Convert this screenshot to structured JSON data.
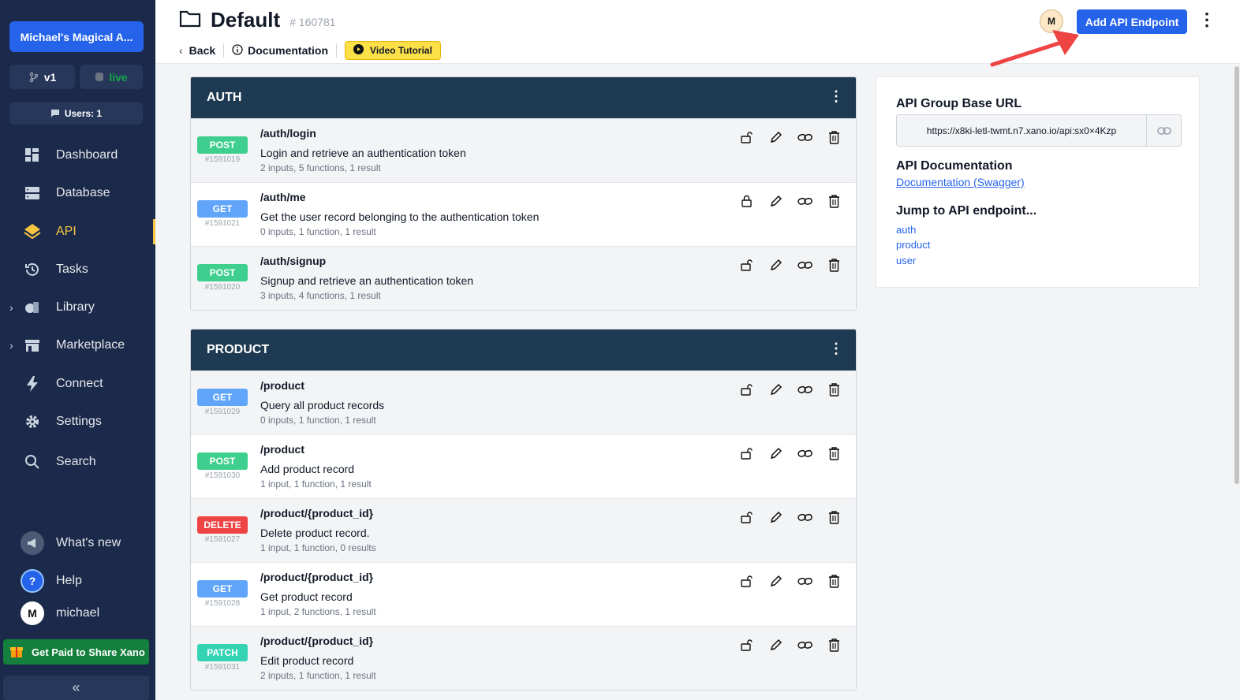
{
  "sidebar": {
    "workspace": "Michael's Magical A...",
    "branch": "v1",
    "datasource": "live",
    "users": "Users: 1",
    "nav": [
      {
        "label": "Dashboard",
        "icon": "dashboard-icon"
      },
      {
        "label": "Database",
        "icon": "database-icon"
      },
      {
        "label": "API",
        "icon": "api-icon",
        "active": true
      },
      {
        "label": "Tasks",
        "icon": "history-icon"
      },
      {
        "label": "Library",
        "icon": "library-icon"
      },
      {
        "label": "Marketplace",
        "icon": "marketplace-icon"
      },
      {
        "label": "Connect",
        "icon": "bolt-icon"
      },
      {
        "label": "Settings",
        "icon": "gear-icon"
      },
      {
        "label": "Search",
        "icon": "search-icon"
      }
    ],
    "whats_new": "What's new",
    "help": "Help",
    "user_initial": "M",
    "user_name": "michael",
    "promo": "Get Paid to Share Xano"
  },
  "header": {
    "title": "Default",
    "id": "# 160781",
    "back": "Back",
    "documentation": "Documentation",
    "video": "Video Tutorial",
    "avatar": "M",
    "add_button": "Add API Endpoint"
  },
  "groups": [
    {
      "name": "AUTH",
      "endpoints": [
        {
          "method": "POST",
          "id": "#1591019",
          "path": "/auth/login",
          "desc": "Login and retrieve an authentication token",
          "meta": "2 inputs, 5 functions, 1 result",
          "lock": "unlocked"
        },
        {
          "method": "GET",
          "id": "#1591021",
          "path": "/auth/me",
          "desc": "Get the user record belonging to the authentication token",
          "meta": "0 inputs, 1 function, 1 result",
          "lock": "locked"
        },
        {
          "method": "POST",
          "id": "#1591020",
          "path": "/auth/signup",
          "desc": "Signup and retrieve an authentication token",
          "meta": "3 inputs, 4 functions, 1 result",
          "lock": "unlocked"
        }
      ]
    },
    {
      "name": "PRODUCT",
      "endpoints": [
        {
          "method": "GET",
          "id": "#1591029",
          "path": "/product",
          "desc": "Query all product records",
          "meta": "0 inputs, 1 function, 1 result",
          "lock": "unlocked"
        },
        {
          "method": "POST",
          "id": "#1591030",
          "path": "/product",
          "desc": "Add product record",
          "meta": "1 input, 1 function, 1 result",
          "lock": "unlocked"
        },
        {
          "method": "DELETE",
          "id": "#1591027",
          "path": "/product/{product_id}",
          "desc": "Delete product record.",
          "meta": "1 input, 1 function, 0 results",
          "lock": "unlocked"
        },
        {
          "method": "GET",
          "id": "#1591028",
          "path": "/product/{product_id}",
          "desc": "Get product record",
          "meta": "1 input, 2 functions, 1 result",
          "lock": "unlocked"
        },
        {
          "method": "PATCH",
          "id": "#1591031",
          "path": "/product/{product_id}",
          "desc": "Edit product record",
          "meta": "2 inputs, 1 function, 1 result",
          "lock": "unlocked"
        }
      ]
    }
  ],
  "panel": {
    "base_url_title": "API Group Base URL",
    "base_url": "https://x8ki-letl-twmt.n7.xano.io/api:sx0×4Kzp",
    "doc_title": "API Documentation",
    "doc_link": "Documentation (Swagger)",
    "jump_title": "Jump to API endpoint...",
    "jump_links": [
      "auth",
      "product",
      "user"
    ]
  },
  "colors": {
    "POST": "#3ecf8e",
    "GET": "#60a5fa",
    "DELETE": "#ef4444",
    "PATCH": "#34d3b4"
  }
}
